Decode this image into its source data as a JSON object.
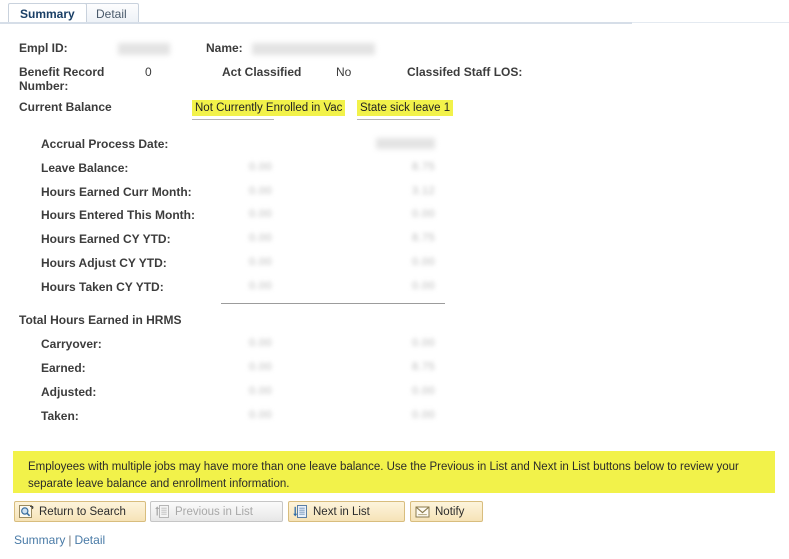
{
  "tabs": [
    {
      "label": "Summary",
      "active": true
    },
    {
      "label": "Detail",
      "active": false
    }
  ],
  "header": {
    "empl_id_label": "Empl ID:",
    "empl_id_value": "",
    "name_label": "Name:",
    "name_value": "",
    "benefit_record_label_line1": "Benefit Record",
    "benefit_record_label_line2": "Number:",
    "benefit_record_value": "0",
    "act_classified_label": "Act Classified",
    "act_classified_value": "No",
    "classified_staff_los_label": "Classifed Staff LOS:",
    "classified_staff_los_value": "",
    "current_balance_label": "Current Balance"
  },
  "columns": [
    {
      "label": "Not Currently Enrolled in Vac"
    },
    {
      "label": "State sick leave 1"
    }
  ],
  "balance_rows": [
    {
      "label": "Accrual Process Date:",
      "col1": "",
      "col2": "08/05/2021"
    },
    {
      "label": "Leave Balance:",
      "col1": "0.00",
      "col2": "8.75"
    },
    {
      "label": "Hours Earned Curr Month:",
      "col1": "0.00",
      "col2": "3.12"
    },
    {
      "label": "Hours Entered This Month:",
      "col1": "0.00",
      "col2": "0.00"
    },
    {
      "label": "Hours Earned CY YTD:",
      "col1": "0.00",
      "col2": "8.75"
    },
    {
      "label": "Hours Adjust CY YTD:",
      "col1": "0.00",
      "col2": "0.00"
    },
    {
      "label": "Hours Taken CY YTD:",
      "col1": "0.00",
      "col2": "0.00"
    }
  ],
  "totals_section": {
    "title": "Total Hours Earned in HRMS",
    "rows": [
      {
        "label": "Carryover:",
        "col1": "0.00",
        "col2": "0.00"
      },
      {
        "label": "Earned:",
        "col1": "0.00",
        "col2": "8.75"
      },
      {
        "label": "Adjusted:",
        "col1": "0.00",
        "col2": "0.00"
      },
      {
        "label": "Taken:",
        "col1": "0.00",
        "col2": "0.00"
      }
    ]
  },
  "notice": {
    "text": "Employees with multiple jobs may have more than one leave balance. Use the Previous in List and Next in List buttons below to review your separate leave balance and enrollment information."
  },
  "buttons": [
    {
      "label": "Return to Search",
      "icon": "return-to-search-icon",
      "disabled": false
    },
    {
      "label": "Previous in List",
      "icon": "previous-in-list-icon",
      "disabled": true
    },
    {
      "label": "Next in List",
      "icon": "next-in-list-icon",
      "disabled": false
    },
    {
      "label": "Notify",
      "icon": "notify-icon",
      "disabled": false
    }
  ],
  "bottom_links": [
    {
      "label": "Summary"
    },
    {
      "label": "Detail"
    }
  ],
  "bottom_link_separator": "|",
  "colors": {
    "highlight": "#f2f24a",
    "button_face": "#f6e3b7",
    "link": "#4a7ba7",
    "tab_active_text": "#1a3f66"
  }
}
